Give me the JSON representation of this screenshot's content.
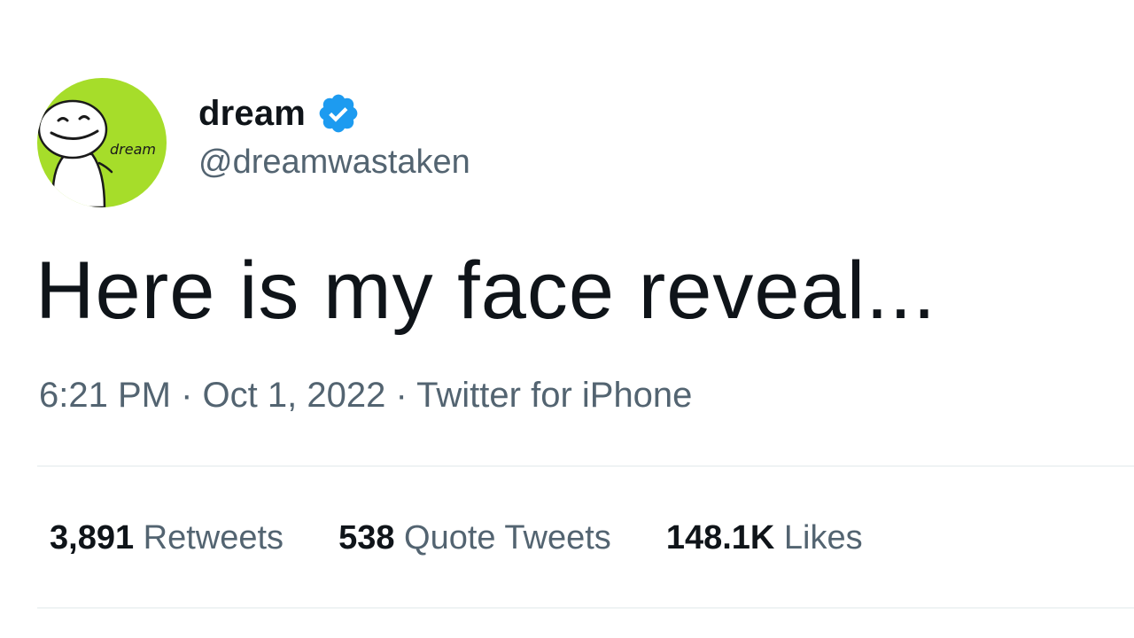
{
  "author": {
    "display_name": "dream",
    "handle": "@dreamwastaken",
    "avatar_text": "dream",
    "avatar_color": "#a6dd2a",
    "verified": true,
    "verified_color": "#1d9bf0"
  },
  "tweet": {
    "text": "Here is my face reveal...",
    "time": "6:21 PM",
    "date": "Oct 1, 2022",
    "source": "Twitter for iPhone",
    "separator": "·"
  },
  "stats": [
    {
      "count": "3,891",
      "label": "Retweets"
    },
    {
      "count": "538",
      "label": "Quote Tweets"
    },
    {
      "count": "148.1K",
      "label": "Likes"
    }
  ],
  "colors": {
    "text_primary": "#0f1419",
    "text_secondary": "#536471",
    "divider": "#eff3f4"
  }
}
